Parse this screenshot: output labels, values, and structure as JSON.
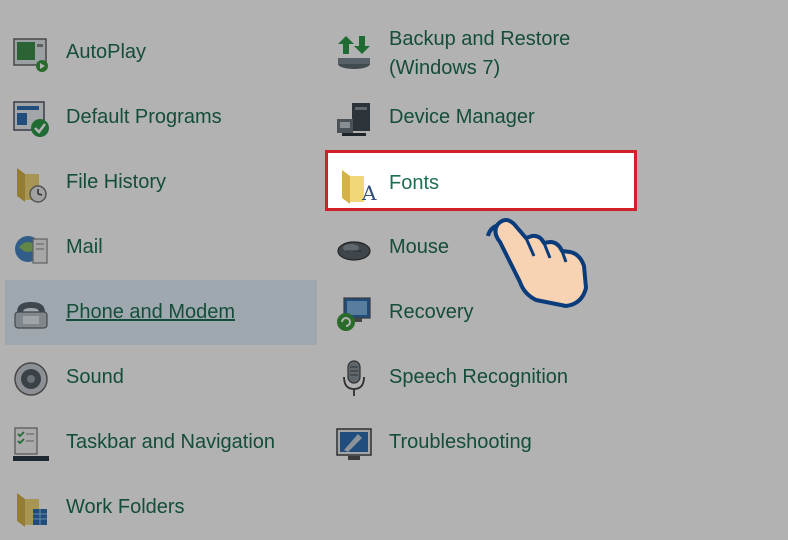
{
  "left_column": [
    {
      "label": "AutoPlay",
      "icon": "autoplay-icon"
    },
    {
      "label": "Default Programs",
      "icon": "default-programs-icon"
    },
    {
      "label": "File History",
      "icon": "file-history-icon"
    },
    {
      "label": "Mail",
      "icon": "mail-icon"
    },
    {
      "label": "Phone and Modem",
      "icon": "phone-modem-icon"
    },
    {
      "label": "Sound",
      "icon": "speaker-icon"
    },
    {
      "label": "Taskbar and Navigation",
      "icon": "taskbar-icon"
    },
    {
      "label": "Work Folders",
      "icon": "work-folders-icon"
    }
  ],
  "right_column": [
    {
      "label_line1": "Backup and Restore",
      "label_line2": "(Windows 7)",
      "icon": "backup-restore-icon"
    },
    {
      "label": "Device Manager",
      "icon": "device-manager-icon"
    },
    {
      "label": "Fonts",
      "icon": "fonts-folder-icon"
    },
    {
      "label": "Mouse",
      "icon": "mouse-icon"
    },
    {
      "label": "Recovery",
      "icon": "recovery-icon"
    },
    {
      "label": "Speech Recognition",
      "icon": "microphone-icon"
    },
    {
      "label": "Troubleshooting",
      "icon": "troubleshooting-icon"
    }
  ],
  "colors": {
    "link": "#1e6f52",
    "highlight_border": "#d0202a",
    "hover_background": "#e5f1fb",
    "dim_overlay": "rgba(0,0,0,0.30)"
  }
}
